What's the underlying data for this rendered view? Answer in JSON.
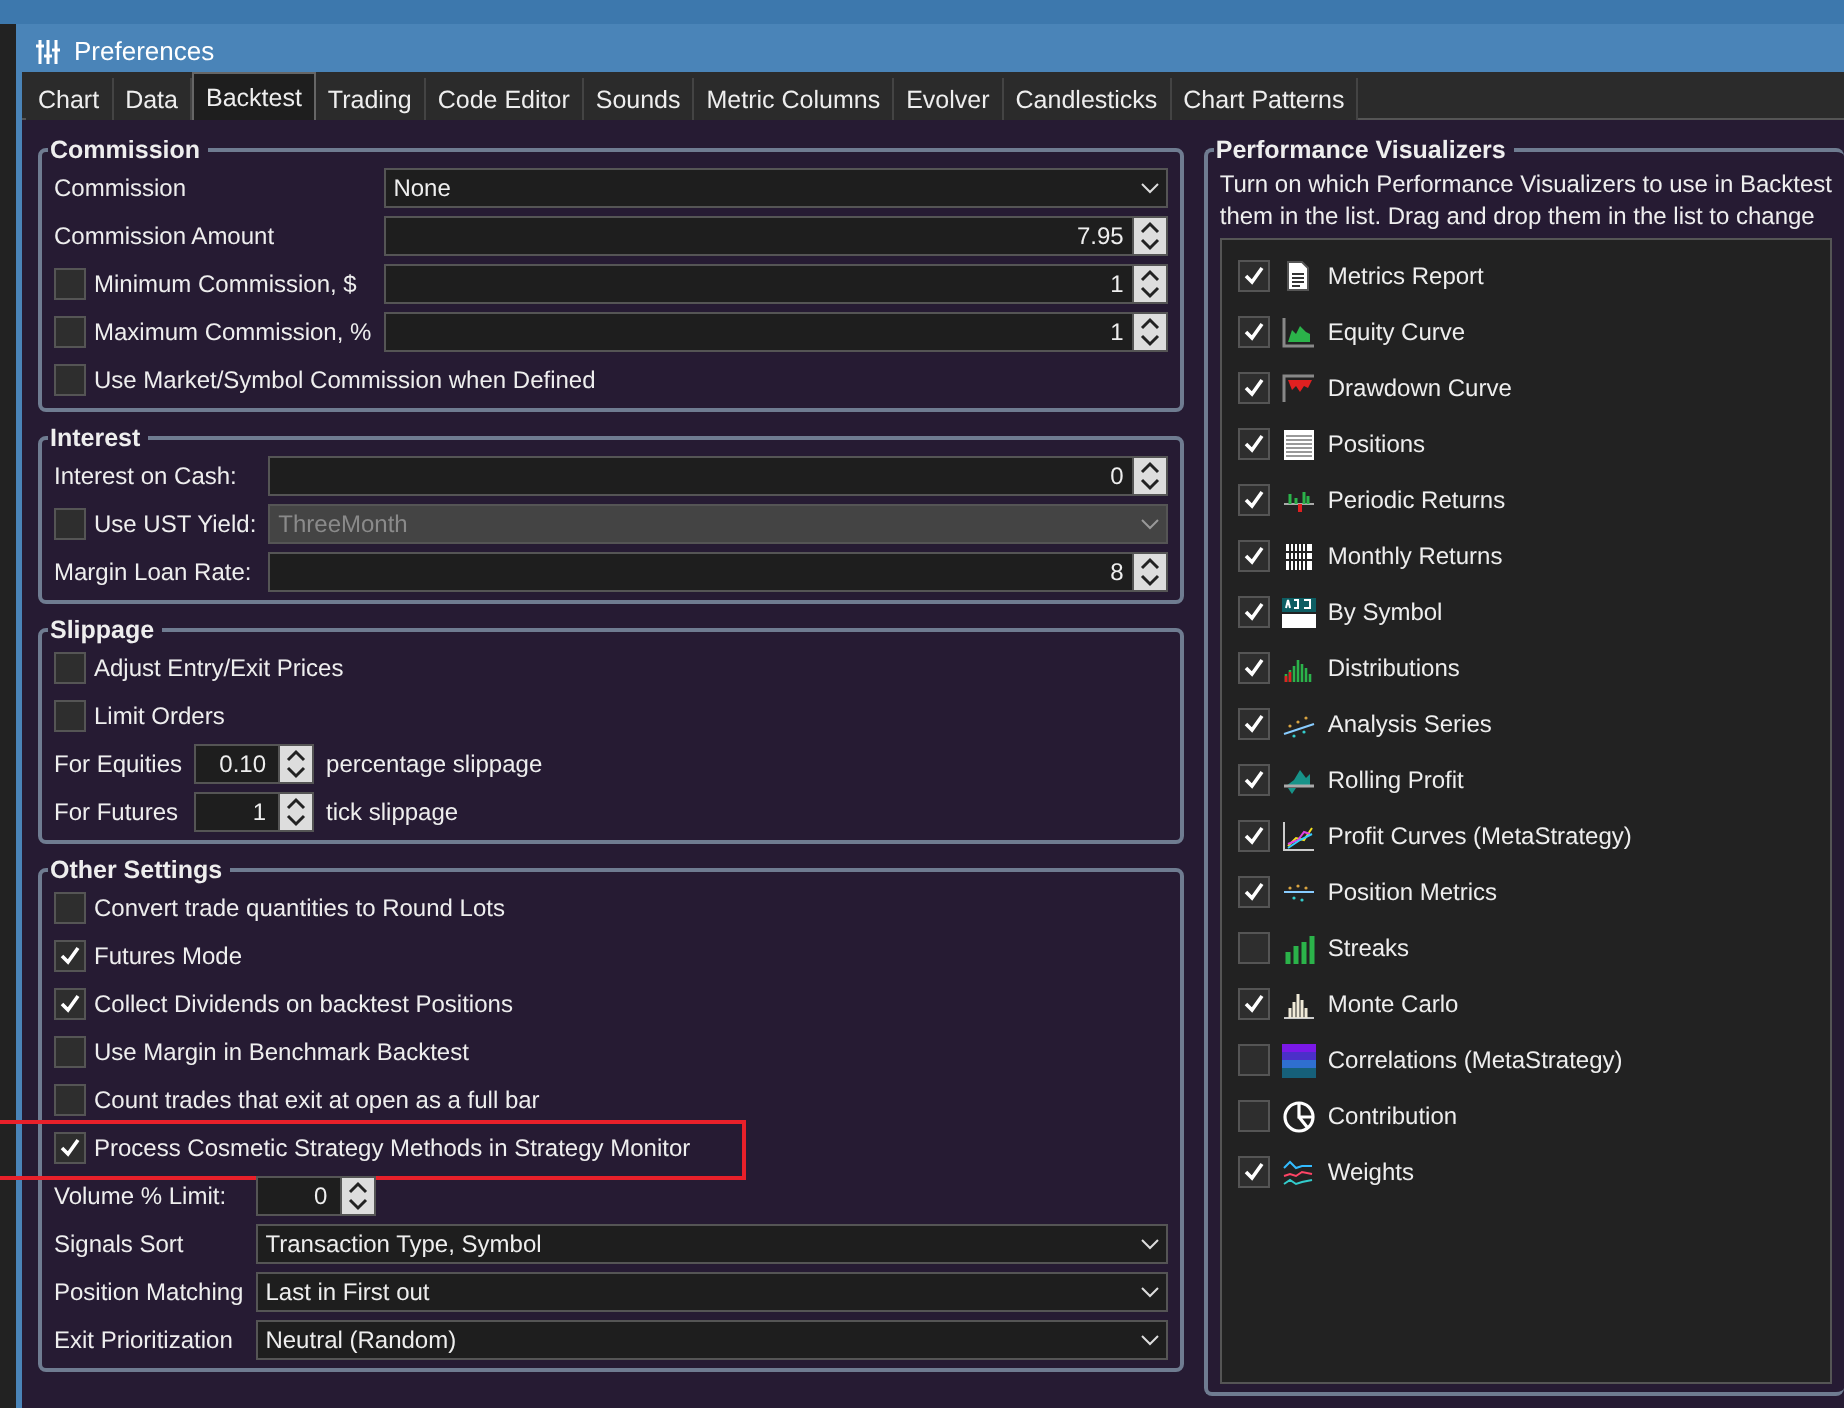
{
  "window": {
    "title": "Preferences"
  },
  "tabs": [
    {
      "label": "Chart",
      "selected": false
    },
    {
      "label": "Data",
      "selected": false
    },
    {
      "label": "Backtest",
      "selected": true
    },
    {
      "label": "Trading",
      "selected": false
    },
    {
      "label": "Code Editor",
      "selected": false
    },
    {
      "label": "Sounds",
      "selected": false
    },
    {
      "label": "Metric Columns",
      "selected": false
    },
    {
      "label": "Evolver",
      "selected": false
    },
    {
      "label": "Candlesticks",
      "selected": false
    },
    {
      "label": "Chart Patterns",
      "selected": false
    }
  ],
  "groups": [
    {
      "title": "Commission",
      "rows": [
        {
          "kind": "select",
          "label": "Commission",
          "value": "None",
          "disabled": false,
          "highlighted": false
        },
        {
          "kind": "number",
          "label": "Commission Amount",
          "value": "7.95",
          "highlighted": false
        },
        {
          "kind": "number",
          "label": "Minimum Commission, $",
          "value": "1",
          "checked": false,
          "highlighted": false
        },
        {
          "kind": "number",
          "label": "Maximum Commission, %",
          "value": "1",
          "checked": false,
          "highlighted": false
        },
        {
          "kind": "checkbox",
          "label": "Use Market/Symbol Commission when Defined",
          "checked": false,
          "highlighted": false
        }
      ]
    },
    {
      "title": "Interest",
      "rows": [
        {
          "kind": "number",
          "label": "Interest on Cash:",
          "value": "0",
          "highlighted": false
        },
        {
          "kind": "select",
          "label": "Use UST Yield:",
          "value": "ThreeMonth",
          "checked": false,
          "disabled": true,
          "highlighted": false
        },
        {
          "kind": "number",
          "label": "Margin Loan Rate:",
          "value": "8",
          "highlighted": false
        }
      ]
    },
    {
      "title": "Slippage",
      "rows": [
        {
          "kind": "checkbox",
          "label": "Adjust Entry/Exit Prices",
          "checked": false,
          "highlighted": false
        },
        {
          "kind": "checkbox",
          "label": "Limit Orders",
          "checked": false,
          "highlighted": false
        },
        {
          "kind": "small_number",
          "label": "For Equities",
          "value": "0.10",
          "suffix": "percentage slippage",
          "highlighted": false
        },
        {
          "kind": "small_number",
          "label": "For Futures",
          "value": "1",
          "suffix": "tick slippage",
          "highlighted": false
        }
      ]
    },
    {
      "title": "Other Settings",
      "rows": [
        {
          "kind": "checkbox",
          "label": "Convert trade quantities to Round Lots",
          "checked": false,
          "highlighted": false
        },
        {
          "kind": "checkbox",
          "label": "Futures Mode",
          "checked": true,
          "highlighted": false
        },
        {
          "kind": "checkbox",
          "label": "Collect Dividends on backtest Positions",
          "checked": true,
          "highlighted": false
        },
        {
          "kind": "checkbox",
          "label": "Use Margin in Benchmark Backtest",
          "checked": false,
          "highlighted": false
        },
        {
          "kind": "checkbox",
          "label": "Count trades that exit at open as a full bar",
          "checked": false,
          "highlighted": false
        },
        {
          "kind": "checkbox",
          "label": "Process Cosmetic Strategy Methods in Strategy Monitor",
          "checked": true,
          "highlighted": true
        },
        {
          "kind": "small_number",
          "label": "Volume % Limit:",
          "value": "0",
          "highlighted": false
        },
        {
          "kind": "select",
          "label": "Signals Sort",
          "value": "Transaction Type, Symbol",
          "disabled": false,
          "highlighted": false
        },
        {
          "kind": "select",
          "label": "Position Matching",
          "value": "Last in First out",
          "disabled": false,
          "highlighted": false
        },
        {
          "kind": "select",
          "label": "Exit Prioritization",
          "value": "Neutral (Random)",
          "disabled": false,
          "highlighted": false
        }
      ]
    }
  ],
  "visualizers": {
    "title": "Performance Visualizers",
    "description_lines": [
      "Turn on which Performance Visualizers to use in Backtest",
      "them in the list. Drag and drop them in the list to change"
    ],
    "items": [
      {
        "label": "Metrics Report",
        "checked": true
      },
      {
        "label": "Equity Curve",
        "checked": true
      },
      {
        "label": "Drawdown Curve",
        "checked": true
      },
      {
        "label": "Positions",
        "checked": true
      },
      {
        "label": "Periodic Returns",
        "checked": true
      },
      {
        "label": "Monthly Returns",
        "checked": true
      },
      {
        "label": "By Symbol",
        "checked": true
      },
      {
        "label": "Distributions",
        "checked": true
      },
      {
        "label": "Analysis Series",
        "checked": true
      },
      {
        "label": "Rolling Profit",
        "checked": true
      },
      {
        "label": "Profit Curves (MetaStrategy)",
        "checked": true
      },
      {
        "label": "Position Metrics",
        "checked": true
      },
      {
        "label": "Streaks",
        "checked": false
      },
      {
        "label": "Monte Carlo",
        "checked": true
      },
      {
        "label": "Correlations (MetaStrategy)",
        "checked": false
      },
      {
        "label": "Contribution",
        "checked": false
      },
      {
        "label": "Weights",
        "checked": true
      }
    ]
  }
}
